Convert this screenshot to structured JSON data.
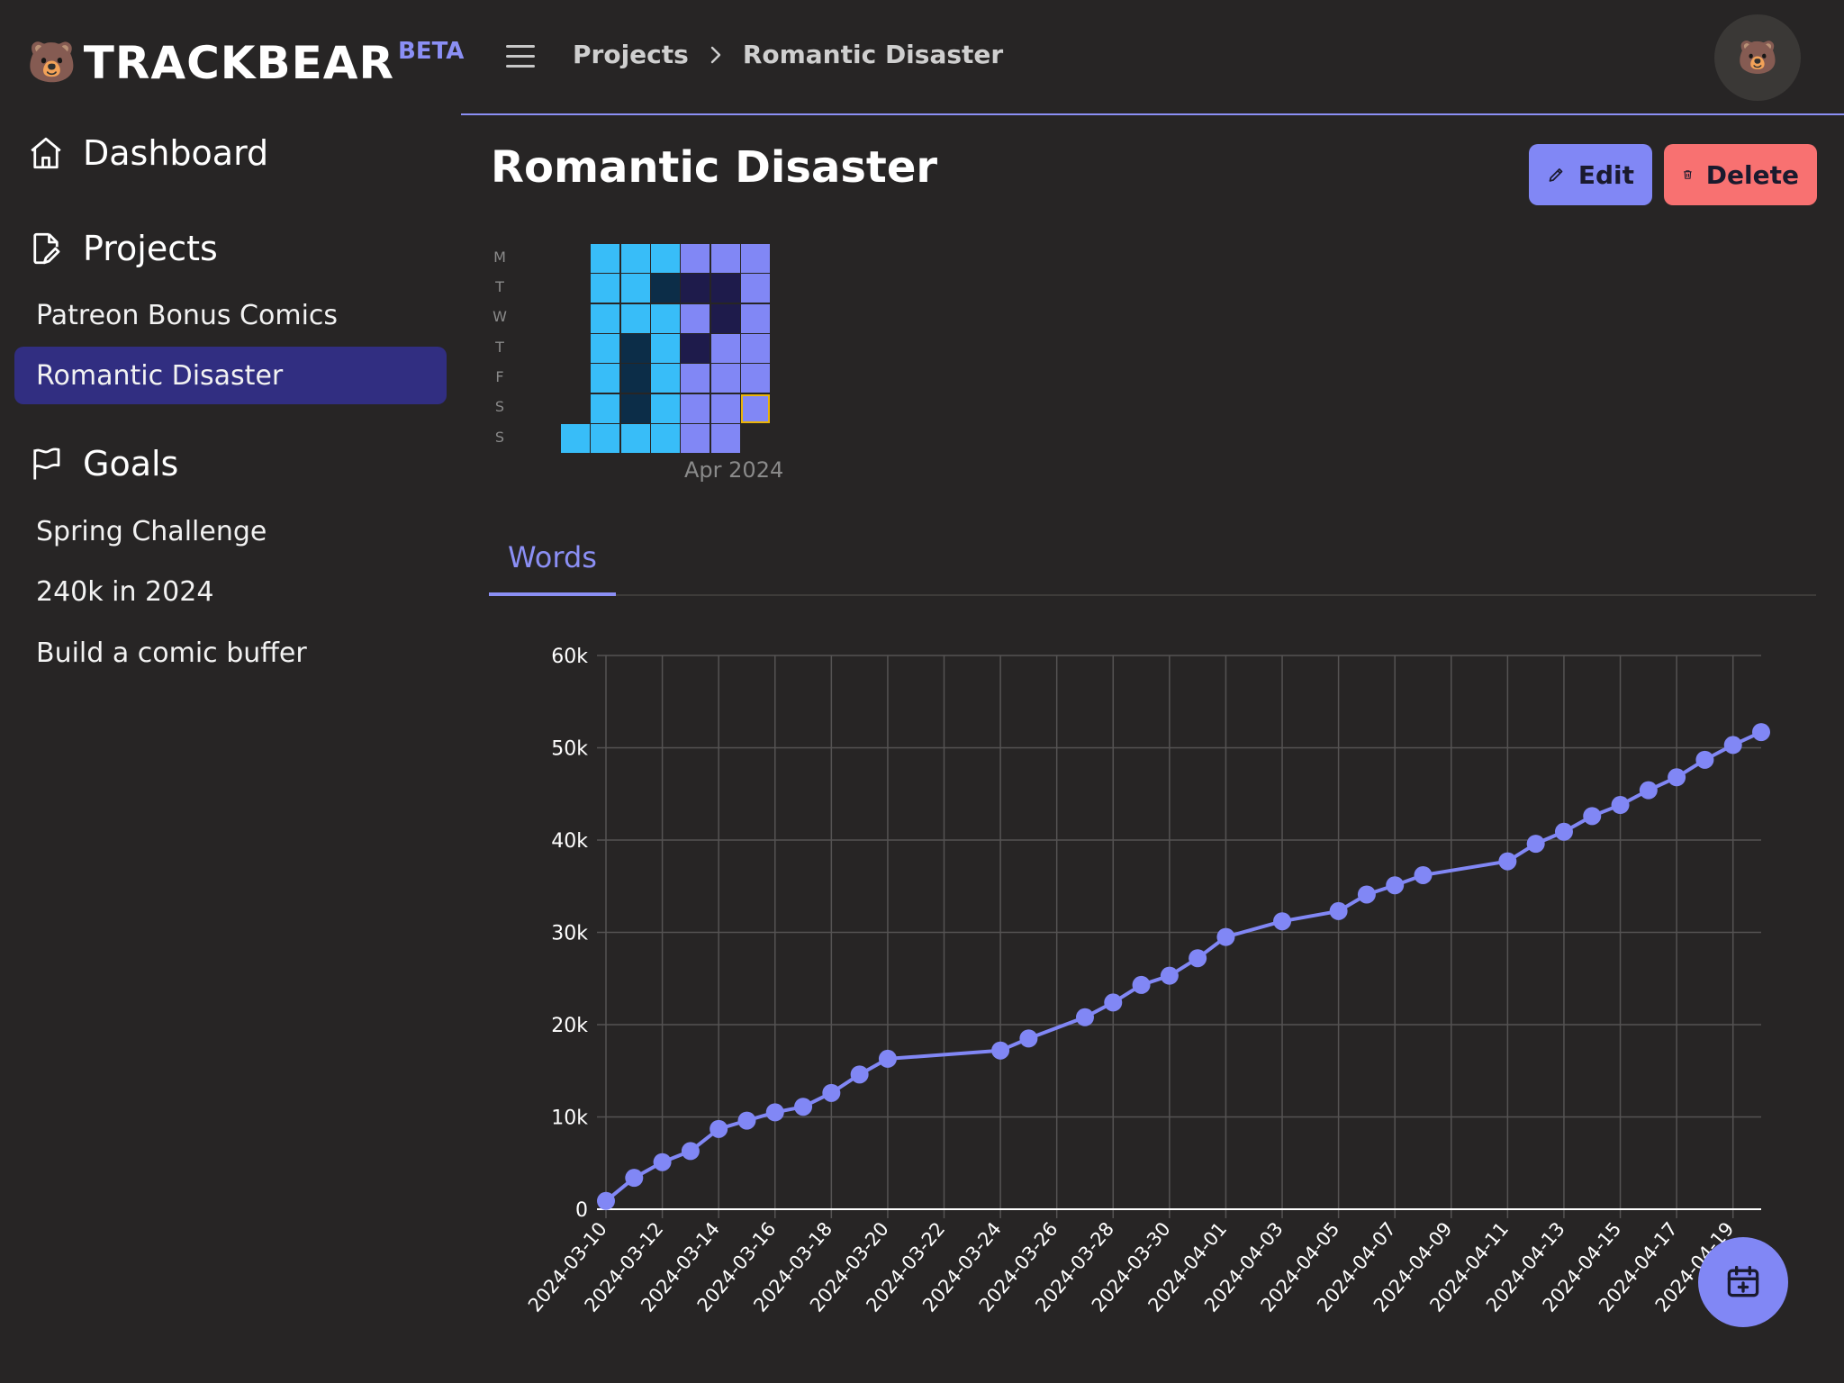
{
  "brand": {
    "emoji": "🐻",
    "name": "TRACKBEAR",
    "badge": "BETA"
  },
  "sidebar": {
    "dashboard_label": "Dashboard",
    "projects_label": "Projects",
    "projects": [
      {
        "label": "Patreon Bonus Comics",
        "active": false
      },
      {
        "label": "Romantic Disaster",
        "active": true
      }
    ],
    "goals_label": "Goals",
    "goals": [
      {
        "label": "Spring Challenge"
      },
      {
        "label": "240k in 2024"
      },
      {
        "label": "Build a comic buffer"
      }
    ]
  },
  "topbar": {
    "breadcrumb": [
      "Projects",
      "Romantic Disaster"
    ],
    "avatar_emoji": "🐻"
  },
  "page": {
    "title": "Romantic Disaster",
    "edit_label": "Edit",
    "delete_label": "Delete"
  },
  "heatmap": {
    "weekday_labels": [
      "M",
      "T",
      "W",
      "T",
      "F",
      "S",
      "S"
    ],
    "month_label": "Apr 2024",
    "colors": {
      "cyan": "#38bdf8",
      "navy": "#0c2d48",
      "lavender": "#8187f5",
      "indigo": "#1e1b4b"
    },
    "columns": [
      [
        null,
        null,
        null,
        null,
        null,
        null,
        "cyan"
      ],
      [
        "cyan",
        "cyan",
        "cyan",
        "cyan",
        "cyan",
        "cyan",
        "cyan"
      ],
      [
        "cyan",
        "cyan",
        "cyan",
        "navy",
        "navy",
        "navy",
        "cyan"
      ],
      [
        "cyan",
        "navy",
        "cyan",
        "cyan",
        "cyan",
        "cyan",
        "cyan"
      ],
      [
        "lavender",
        "indigo",
        "lavender",
        "indigo",
        "lavender",
        "lavender",
        "lavender"
      ],
      [
        "lavender",
        "indigo",
        "indigo",
        "lavender",
        "lavender",
        "lavender",
        "lavender"
      ],
      [
        "lavender",
        "lavender",
        "lavender",
        "lavender",
        "lavender",
        "lavender",
        null
      ]
    ],
    "today_highlight": {
      "column": 6,
      "row": 5,
      "color": "#eab308"
    }
  },
  "tabs": [
    {
      "label": "Words",
      "active": true
    }
  ],
  "chart_data": {
    "type": "line",
    "series": [
      {
        "color": "#8187f5",
        "points": [
          [
            "2024-03-10",
            900
          ],
          [
            "2024-03-11",
            3400
          ],
          [
            "2024-03-12",
            5100
          ],
          [
            "2024-03-13",
            6300
          ],
          [
            "2024-03-14",
            8700
          ],
          [
            "2024-03-15",
            9600
          ],
          [
            "2024-03-16",
            10500
          ],
          [
            "2024-03-17",
            11100
          ],
          [
            "2024-03-18",
            12600
          ],
          [
            "2024-03-19",
            14600
          ],
          [
            "2024-03-20",
            16300
          ],
          [
            "2024-03-24",
            17200
          ],
          [
            "2024-03-25",
            18500
          ],
          [
            "2024-03-27",
            20800
          ],
          [
            "2024-03-28",
            22400
          ],
          [
            "2024-03-29",
            24300
          ],
          [
            "2024-03-30",
            25300
          ],
          [
            "2024-03-31",
            27200
          ],
          [
            "2024-04-01",
            29500
          ],
          [
            "2024-04-03",
            31200
          ],
          [
            "2024-04-05",
            32300
          ],
          [
            "2024-04-06",
            34100
          ],
          [
            "2024-04-07",
            35100
          ],
          [
            "2024-04-08",
            36200
          ],
          [
            "2024-04-11",
            37700
          ],
          [
            "2024-04-12",
            39600
          ],
          [
            "2024-04-13",
            40900
          ],
          [
            "2024-04-14",
            42600
          ],
          [
            "2024-04-15",
            43800
          ],
          [
            "2024-04-16",
            45400
          ],
          [
            "2024-04-17",
            46800
          ],
          [
            "2024-04-18",
            48700
          ],
          [
            "2024-04-19",
            50300
          ],
          [
            "2024-04-20",
            51700
          ]
        ]
      }
    ],
    "y_ticks": [
      "0",
      "10k",
      "20k",
      "30k",
      "40k",
      "50k",
      "60k"
    ],
    "ylim": [
      0,
      60000
    ],
    "x_ticks": [
      "2024-03-10",
      "2024-03-12",
      "2024-03-14",
      "2024-03-16",
      "2024-03-18",
      "2024-03-20",
      "2024-03-22",
      "2024-03-24",
      "2024-03-26",
      "2024-03-28",
      "2024-03-30",
      "2024-04-01",
      "2024-04-03",
      "2024-04-05",
      "2024-04-07",
      "2024-04-09",
      "2024-04-11",
      "2024-04-13",
      "2024-04-15",
      "2024-04-17",
      "2024-04-19"
    ],
    "xlim": [
      "2024-03-10",
      "2024-04-20"
    ],
    "grid": true,
    "grid_color": "#555353"
  },
  "fab": {
    "icon": "calendar-plus-icon"
  }
}
